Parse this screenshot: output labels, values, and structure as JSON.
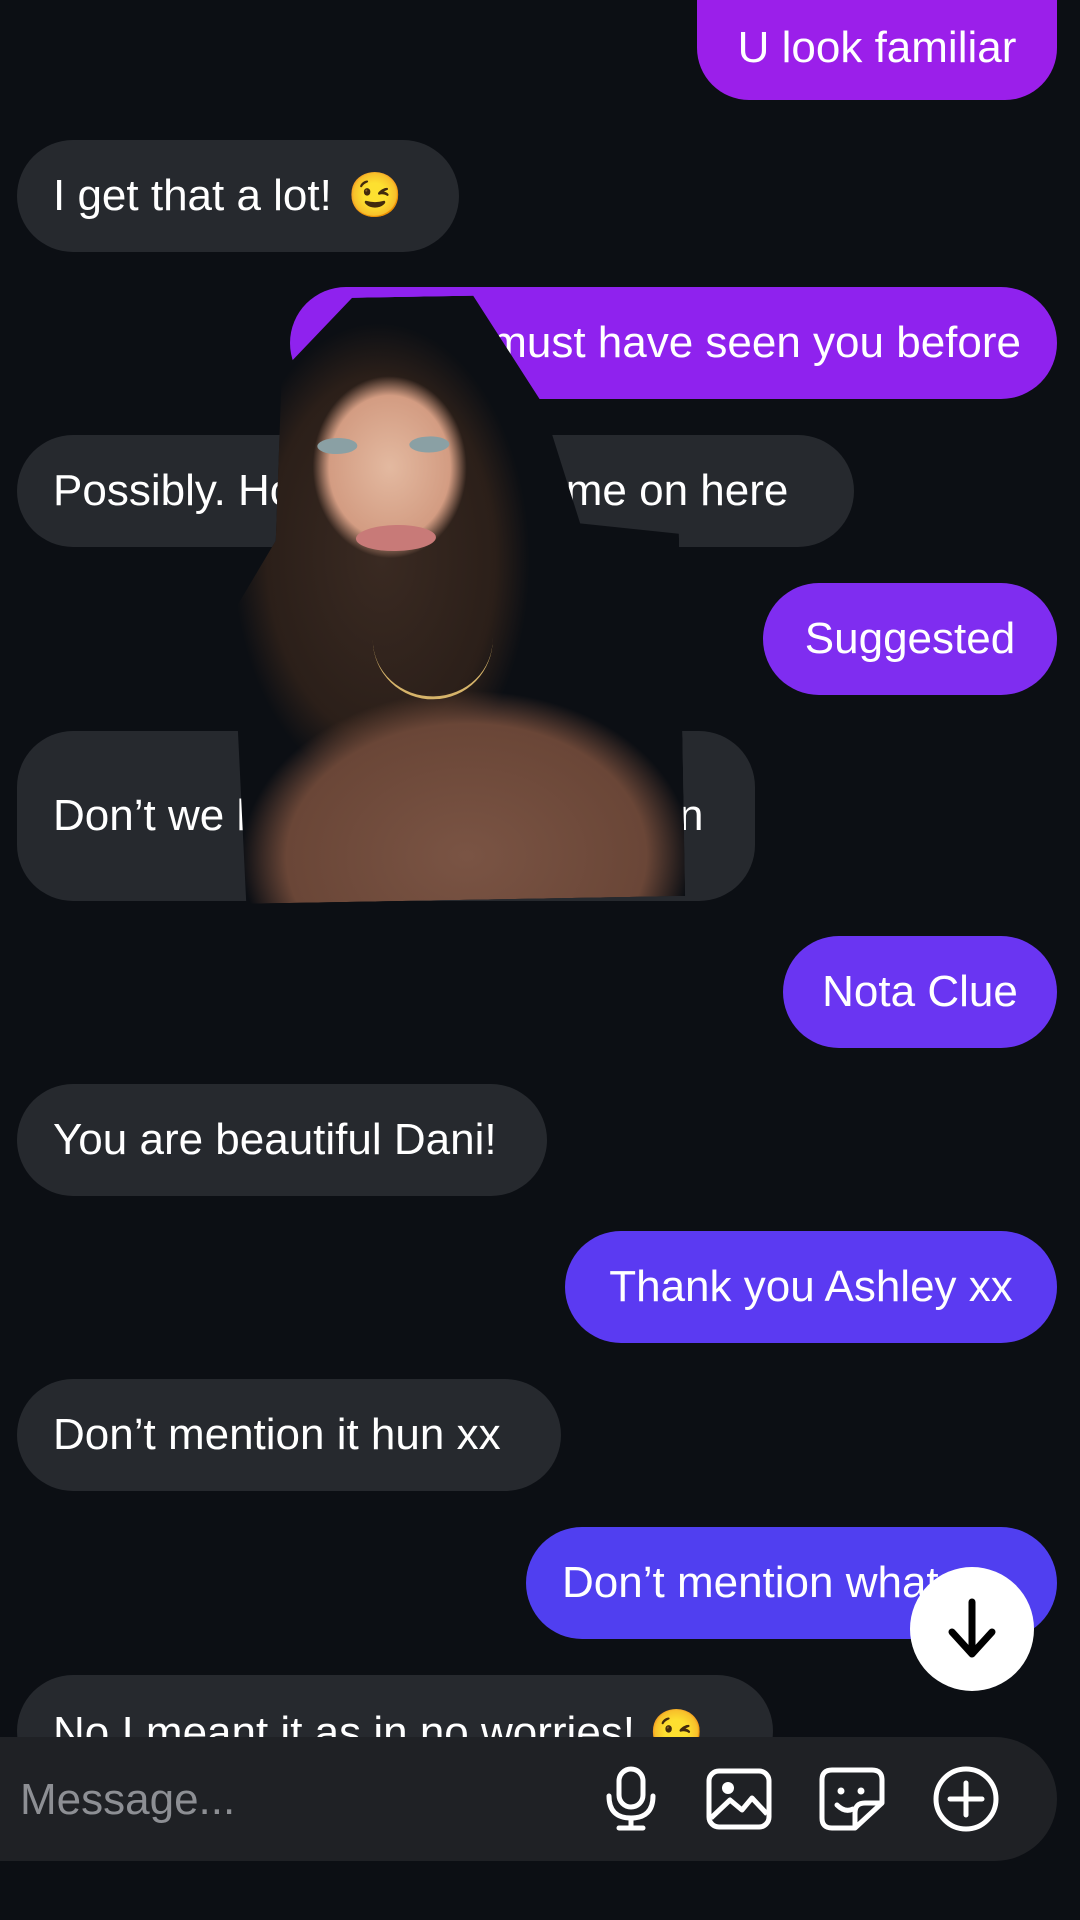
{
  "messages": [
    {
      "side": "out",
      "text": "U look familiar",
      "color": "#9b1fea"
    },
    {
      "side": "in",
      "text": "I get that a lot!",
      "emoji": "😉"
    },
    {
      "side": "out",
      "text": "I must have seen you before",
      "color": "#8f22ee"
    },
    {
      "side": "in",
      "text": "Possibly. How did you get me on here"
    },
    {
      "side": "out",
      "text": "Suggested",
      "color": "#7f2df0"
    },
    {
      "side": "in",
      "text": "Don’t we have friends in common"
    },
    {
      "side": "out",
      "text": "Nota Clue",
      "color": "#6a35f2"
    },
    {
      "side": "in",
      "text": "You are beautiful Dani!"
    },
    {
      "side": "out",
      "text": "Thank you Ashley xx",
      "color": "#5b3af2"
    },
    {
      "side": "in",
      "text": "Don’t mention it hun xx"
    },
    {
      "side": "out",
      "text": "Don’t mention what xx",
      "color": "#503ff0"
    },
    {
      "side": "in",
      "text": "No I meant it as in no worries!",
      "emoji": "😉"
    }
  ],
  "composer": {
    "placeholder": "Message..."
  },
  "icons": {
    "mic": "microphone-icon",
    "gallery": "image-icon",
    "sticker": "sticker-icon",
    "more": "plus-circle-icon",
    "scroll": "arrow-down-icon"
  }
}
